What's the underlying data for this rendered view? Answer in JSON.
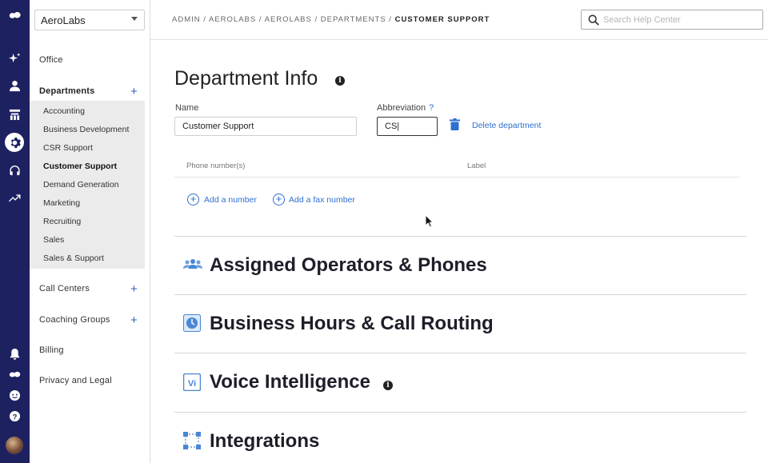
{
  "org_selector": {
    "value": "AeroLabs"
  },
  "rail": {
    "icons": [
      "logo-icon",
      "sparkle-icon",
      "person-icon",
      "org-icon",
      "settings-icon",
      "headset-icon",
      "analytics-icon",
      "bell-icon",
      "brand-icon",
      "face-icon",
      "help-icon",
      "avatar"
    ]
  },
  "sidebar": {
    "office": "Office",
    "departments": "Departments",
    "department_items": [
      "Accounting",
      "Business Development",
      "CSR Support",
      "Customer Support",
      "Demand Generation",
      "Marketing",
      "Recruiting",
      "Sales",
      "Sales & Support"
    ],
    "active_department": "Customer Support",
    "call_centers": "Call Centers",
    "coaching_groups": "Coaching Groups",
    "billing": "Billing",
    "privacy": "Privacy and Legal"
  },
  "breadcrumb": {
    "path": "ADMIN / AEROLABS / AEROLABS / DEPARTMENTS /",
    "current": "CUSTOMER SUPPORT"
  },
  "search": {
    "placeholder": "Search Help Center"
  },
  "dept_info": {
    "title": "Department Info",
    "name_label": "Name",
    "name_value": "Customer Support",
    "abbr_label": "Abbreviation",
    "abbr_help": "?",
    "abbr_value": "CS|",
    "delete_label": "Delete department",
    "phone_col": "Phone number(s)",
    "label_col": "Label",
    "add_number": "Add a number",
    "add_fax": "Add a fax number"
  },
  "sections": [
    {
      "title": "Assigned Operators & Phones",
      "icon": "operators-icon"
    },
    {
      "title": "Business Hours & Call Routing",
      "icon": "clock-icon"
    },
    {
      "title": "Voice Intelligence",
      "icon": "vi-icon"
    },
    {
      "title": "Integrations",
      "icon": "integrations-icon"
    }
  ],
  "colors": {
    "rail": "#1d2160",
    "accent": "#2f6fd0",
    "sidebar_sub": "#ebebeb"
  }
}
